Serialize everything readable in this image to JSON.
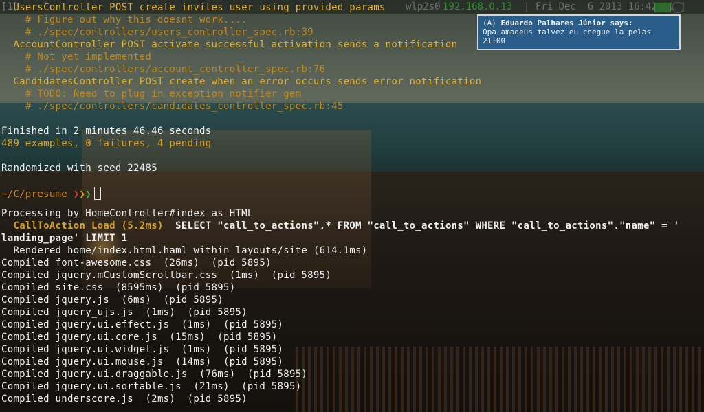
{
  "statusbar": {
    "workspace_tag": "[1]",
    "interface": "wlp2s0",
    "ip": "192.168.0.13",
    "datetime": "| Fri Dec  6 2013 16:42:21 |"
  },
  "notification": {
    "prefix": "(A)",
    "sender": "Eduardo Palhares Júnior says:",
    "message": "Opa amadeus talvez eu chegue la pelas",
    "message2": "21:00"
  },
  "terminal": {
    "pending": [
      {
        "title": "UsersController POST create invites user using provided params",
        "note": "# Figure out why this doesnt work....",
        "location": "# ./spec/controllers/users_controller_spec.rb:39"
      },
      {
        "title": "AccountController POST activate successful activation sends a notification",
        "note": "# Not yet implemented",
        "location": "# ./spec/controllers/account_controller_spec.rb:76"
      },
      {
        "title": "CandidatesController POST create when an error occurs sends error notification",
        "note": "# TODO: Need to plug in exception notifier gem",
        "location": "# ./spec/controllers/candidates_controller_spec.rb:45"
      }
    ],
    "finished": "Finished in 2 minutes 46.46 seconds",
    "summary": "489 examples, 0 failures, 4 pending",
    "seed": "Randomized with seed 22485",
    "prompt_path": "~/C/presume",
    "chevrons": [
      "❯",
      "❯",
      "❯"
    ],
    "processing": "Processing by HomeController#index as HTML",
    "sql_tag": "CallToAction Load (5.2ms)",
    "sql_query": "SELECT \"call_to_actions\".* FROM \"call_to_actions\" WHERE \"call_to_actions\".\"name\" = '",
    "sql_query_cont": "landing_page' LIMIT 1",
    "rendered": "  Rendered home/index.html.haml within layouts/site (614.1ms)",
    "compiled": [
      "Compiled font-awesome.css  (26ms)  (pid 5895)",
      "Compiled jquery.mCustomScrollbar.css  (1ms)  (pid 5895)",
      "Compiled site.css  (8595ms)  (pid 5895)",
      "Compiled jquery.js  (6ms)  (pid 5895)",
      "Compiled jquery_ujs.js  (1ms)  (pid 5895)",
      "Compiled jquery.ui.effect.js  (1ms)  (pid 5895)",
      "Compiled jquery.ui.core.js  (15ms)  (pid 5895)",
      "Compiled jquery.ui.widget.js  (1ms)  (pid 5895)",
      "Compiled jquery.ui.mouse.js  (14ms)  (pid 5895)",
      "Compiled jquery.ui.draggable.js  (76ms)  (pid 5895)",
      "Compiled jquery.ui.sortable.js  (21ms)  (pid 5895)",
      "Compiled underscore.js  (2ms)  (pid 5895)"
    ]
  },
  "colors": {
    "pending": "#e0b030",
    "comment": "#c0881f",
    "notification_bg": "#2a5d8a",
    "ip": "#2f8f2f"
  },
  "icons": [
    "volume-icon",
    "battery-icon",
    "tray-icon"
  ]
}
